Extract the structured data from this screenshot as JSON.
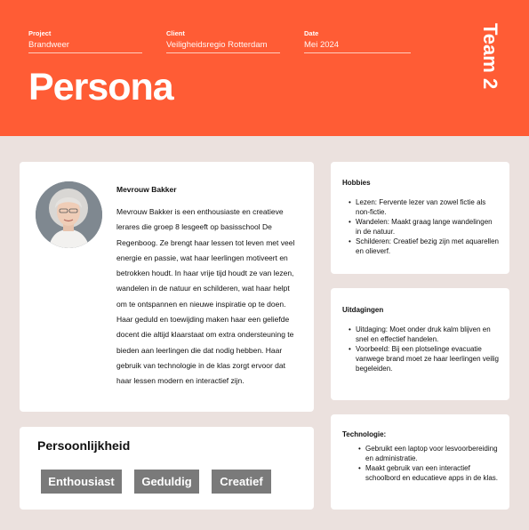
{
  "header": {
    "project_label": "Project",
    "project_value": "Brandweer",
    "client_label": "Client",
    "client_value": "Veiligheidsregio Rotterdam",
    "date_label": "Date",
    "date_value": "Mei 2024",
    "title": "Persona",
    "team": "Team 2"
  },
  "persona": {
    "name": "Mevrouw Bakker",
    "bio": "Mevrouw Bakker is een enthousiaste en creatieve lerares die groep 8 lesgeeft op basisschool De Regenboog. Ze brengt haar lessen tot leven met veel energie en passie, wat haar leerlingen motiveert en betrokken houdt. In haar vrije tijd houdt ze van lezen, wandelen in de natuur en schilderen, wat haar helpt om te ontspannen en nieuwe inspiratie op te doen. Haar geduld en toewijding maken haar een geliefde docent die altijd klaarstaat om extra ondersteuning te bieden aan leerlingen die dat nodig hebben. Haar gebruik van technologie in de klas zorgt ervoor dat haar lessen modern en interactief zijn."
  },
  "personality": {
    "heading": "Persoonlijkheid",
    "tags": [
      "Enthousiast",
      "Geduldig",
      "Creatief"
    ]
  },
  "hobbies": {
    "heading": "Hobbies",
    "items": [
      "Lezen: Fervente lezer van zowel fictie als non-fictie.",
      "Wandelen: Maakt graag lange wandelingen in de natuur.",
      "Schilderen: Creatief bezig zijn met aquarellen en olieverf."
    ]
  },
  "challenges": {
    "heading": "Uitdagingen",
    "items": [
      "Uitdaging: Moet onder druk kalm blijven en snel en effectief handelen.",
      "Voorbeeld: Bij een plotselinge evacuatie vanwege brand moet ze haar leerlingen veilig begeleiden."
    ]
  },
  "technology": {
    "heading": "Technologie:",
    "items": [
      "Gebruikt een laptop voor lesvoorbereiding en administratie.",
      "Maakt gebruik van een interactief schoolbord en educatieve apps in de klas."
    ]
  },
  "colors": {
    "header": "#ff5c35",
    "page": "#ebe1de",
    "tag": "#7a7a7a"
  }
}
